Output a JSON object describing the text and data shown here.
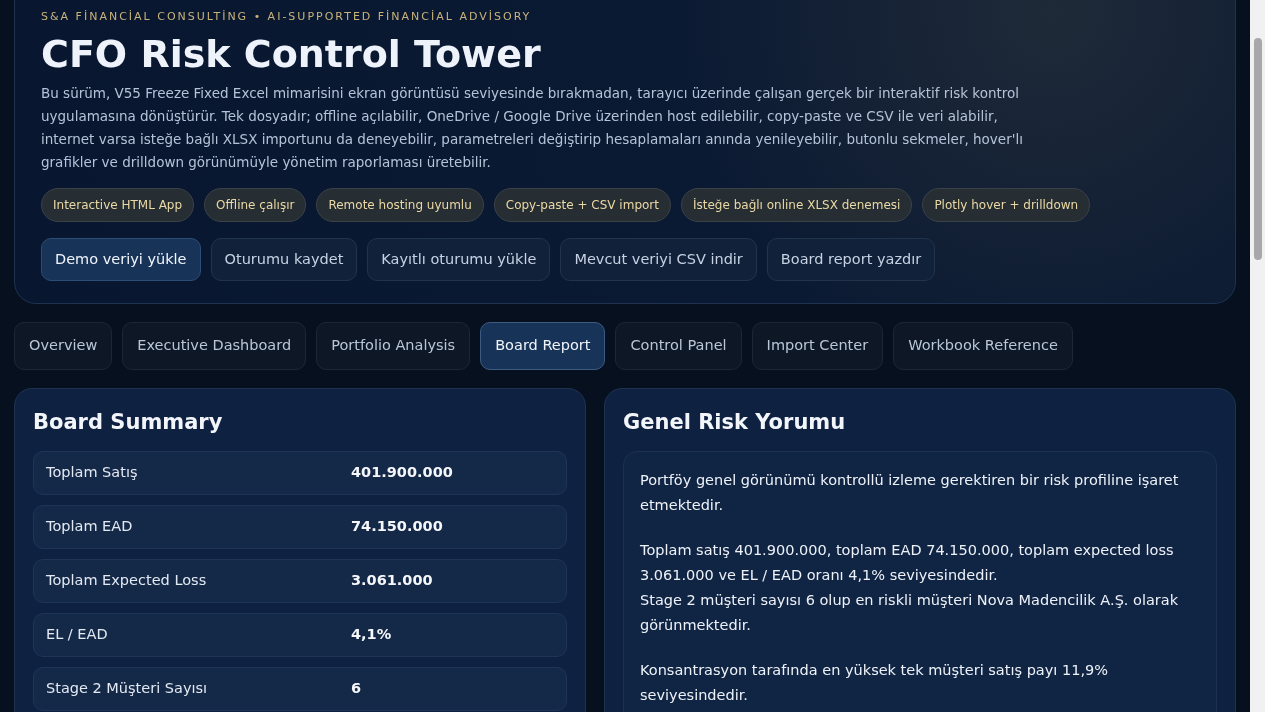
{
  "header": {
    "eyebrow": "S&A FİNANCİAL CONSULTİNG • AI-SUPPORTED FİNANCİAL ADVİSORY",
    "title": "CFO Risk Control Tower",
    "description": "Bu sürüm, V55 Freeze Fixed Excel mimarisini ekran görüntüsü seviyesinde bırakmadan, tarayıcı üzerinde çalışan gerçek bir interaktif risk kontrol uygulamasına dönüştürür. Tek dosyadır; offline açılabilir, OneDrive / Google Drive üzerinden host edilebilir, copy-paste ve CSV ile veri alabilir, internet varsa isteğe bağlı XLSX importunu da deneyebilir, parametreleri değiştirip hesaplamaları anında yenileyebilir, butonlu sekmeler, hover'lı grafikler ve drilldown görünümüyle yönetim raporlaması üretebilir.",
    "chips": [
      "Interactive HTML App",
      "Offline çalışır",
      "Remote hosting uyumlu",
      "Copy-paste + CSV import",
      "İsteğe bağlı online XLSX denemesi",
      "Plotly hover + drilldown"
    ],
    "actions": [
      {
        "label": "Demo veriyi yükle",
        "selected": true
      },
      {
        "label": "Oturumu kaydet",
        "selected": false
      },
      {
        "label": "Kayıtlı oturumu yükle",
        "selected": false
      },
      {
        "label": "Mevcut veriyi CSV indir",
        "selected": false
      },
      {
        "label": "Board report yazdır",
        "selected": false
      }
    ]
  },
  "tabs": [
    {
      "label": "Overview",
      "selected": false
    },
    {
      "label": "Executive Dashboard",
      "selected": false
    },
    {
      "label": "Portfolio Analysis",
      "selected": false
    },
    {
      "label": "Board Report",
      "selected": true
    },
    {
      "label": "Control Panel",
      "selected": false
    },
    {
      "label": "Import Center",
      "selected": false
    },
    {
      "label": "Workbook Reference",
      "selected": false
    }
  ],
  "board_summary": {
    "title": "Board Summary",
    "rows": [
      {
        "label": "Toplam Satış",
        "value": "401.900.000"
      },
      {
        "label": "Toplam EAD",
        "value": "74.150.000"
      },
      {
        "label": "Toplam Expected Loss",
        "value": "3.061.000"
      },
      {
        "label": "EL / EAD",
        "value": "4,1%"
      },
      {
        "label": "Stage 2 Müşteri Sayısı",
        "value": "6"
      }
    ]
  },
  "risk_commentary": {
    "title": "Genel Risk Yorumu",
    "paragraphs": [
      [
        "Portföy genel görünümü kontrollü izleme gerektiren bir risk profiline işaret etmektedir."
      ],
      [
        "Toplam satış 401.900.000, toplam EAD 74.150.000, toplam expected loss 3.061.000 ve EL / EAD oranı 4,1% seviyesindedir.",
        "Stage 2 müşteri sayısı 6 olup en riskli müşteri Nova Madencilik A.Ş. olarak görünmektedir."
      ],
      [
        "Konsantrasyon tarafında en yüksek tek müşteri satış payı 11,9% seviyesindedir."
      ]
    ]
  }
}
